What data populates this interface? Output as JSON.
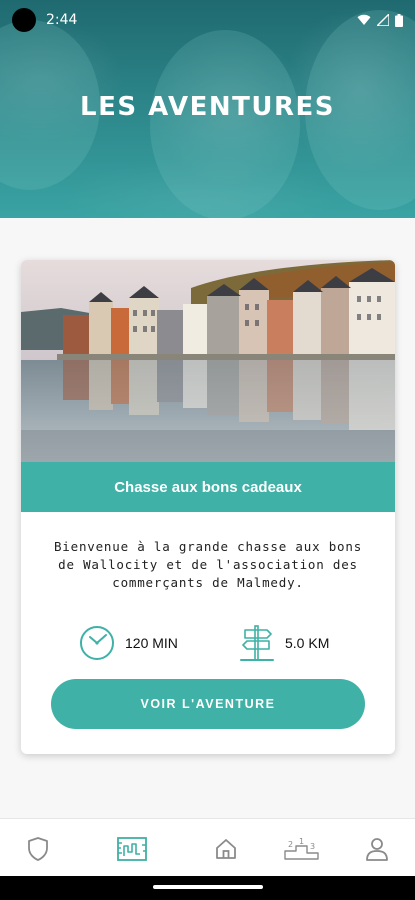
{
  "status_bar": {
    "time": "2:44"
  },
  "header": {
    "title": "LES AVENTURES"
  },
  "card": {
    "banner_title": "Chasse aux bons cadeaux",
    "description": "Bienvenue à la grande chasse aux bons de Wallocity et de l'association des commerçants de Malmedy.",
    "duration": {
      "icon": "clock-icon",
      "label": "120 MIN"
    },
    "distance": {
      "icon": "signpost-icon",
      "label": "5.0 KM"
    },
    "cta_label": "VOIR L'AVENTURE"
  },
  "bottom_nav": {
    "items": [
      {
        "name": "shield-icon",
        "active": false
      },
      {
        "name": "map-icon",
        "active": true
      },
      {
        "name": "home-icon",
        "active": false
      },
      {
        "name": "podium-icon",
        "active": false
      },
      {
        "name": "user-icon",
        "active": false
      }
    ]
  },
  "colors": {
    "accent": "#3fb1a6",
    "header_dark": "#1f6a70",
    "inactive_icon": "#8a8a8a"
  }
}
